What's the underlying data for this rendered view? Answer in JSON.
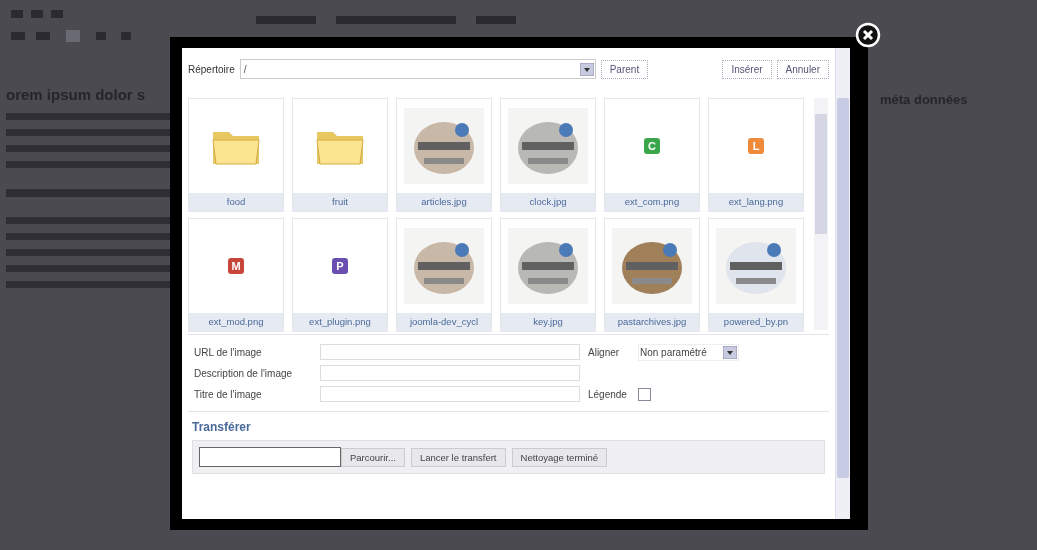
{
  "editor": {
    "heading": "orem ipsum dolor s",
    "sidebar_text": "méta données"
  },
  "dialog": {
    "directory_label": "Répertoire",
    "directory_value": "/",
    "parent": "Parent",
    "insert": "Insérer",
    "cancel": "Annuler",
    "items": [
      {
        "kind": "folder",
        "name": "food"
      },
      {
        "kind": "folder",
        "name": "fruit"
      },
      {
        "kind": "picture",
        "name": "articles.jpg"
      },
      {
        "kind": "picture",
        "name": "clock.jpg"
      },
      {
        "kind": "badge",
        "letter": "C",
        "color": "#3aa64a",
        "name": "ext_com.png"
      },
      {
        "kind": "badge",
        "letter": "L",
        "color": "#ee8a3a",
        "name": "ext_lang.png"
      },
      {
        "kind": "badge",
        "letter": "M",
        "color": "#c8453a",
        "name": "ext_mod.png"
      },
      {
        "kind": "badge",
        "letter": "P",
        "color": "#6a4fb0",
        "name": "ext_plugin.png"
      },
      {
        "kind": "picture",
        "name": "joomla-dev_cycl"
      },
      {
        "kind": "picture",
        "name": "key.jpg"
      },
      {
        "kind": "picture",
        "name": "pastarchives.jpg"
      },
      {
        "kind": "picture",
        "name": "powered_by.pn"
      }
    ],
    "fields": [
      {
        "label": "URL de l'image"
      },
      {
        "label": "Description de l'image"
      },
      {
        "label": "Titre de l'image"
      }
    ],
    "align": {
      "label": "Aligner",
      "value": "Non paramétré"
    },
    "caption": {
      "label": "Légende",
      "checked": false
    },
    "upload": {
      "title": "Transférer",
      "browse": "Parcourir...",
      "start": "Lancer le transfert",
      "clear": "Nettoyage terminé"
    }
  }
}
